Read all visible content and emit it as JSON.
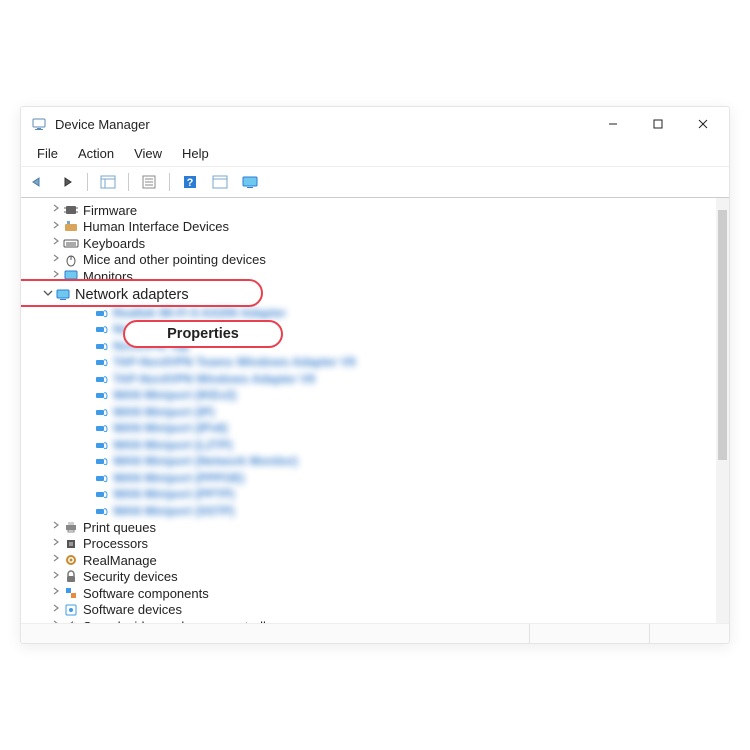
{
  "window": {
    "title": "Device Manager"
  },
  "menubar": {
    "file": "File",
    "action": "Action",
    "view": "View",
    "help": "Help"
  },
  "contextmenu": {
    "properties": "Properties"
  },
  "tree": {
    "collapsed": [
      {
        "label": "Firmware",
        "icon": "chip"
      },
      {
        "label": "Human Interface Devices",
        "icon": "hid"
      },
      {
        "label": "Keyboards",
        "icon": "keyboard"
      },
      {
        "label": "Mice and other pointing devices",
        "icon": "mouse"
      },
      {
        "label": "Monitors",
        "icon": "monitor"
      }
    ],
    "expanded": {
      "label": "Network adapters",
      "icon": "net"
    },
    "adapters": [
      "Realtek Wi-Fi 6 AX200 Adapter",
      "NordLynx",
      "NordVPN Tap",
      "TAP-NordVPN Teams Windows Adapter V9",
      "TAP-NordVPN Windows Adapter V9",
      "WAN Miniport (IKEv2)",
      "WAN Miniport (IP)",
      "WAN Miniport (IPv6)",
      "WAN Miniport (L2TP)",
      "WAN Miniport (Network Monitor)",
      "WAN Miniport (PPPOE)",
      "WAN Miniport (PPTP)",
      "WAN Miniport (SSTP)"
    ],
    "after": [
      {
        "label": "Print queues",
        "icon": "printer"
      },
      {
        "label": "Processors",
        "icon": "cpu"
      },
      {
        "label": "RealManage",
        "icon": "gear"
      },
      {
        "label": "Security devices",
        "icon": "lock"
      },
      {
        "label": "Software components",
        "icon": "component"
      },
      {
        "label": "Software devices",
        "icon": "swdev"
      },
      {
        "label": "Sound, video and game controllers",
        "icon": "sound"
      }
    ]
  }
}
